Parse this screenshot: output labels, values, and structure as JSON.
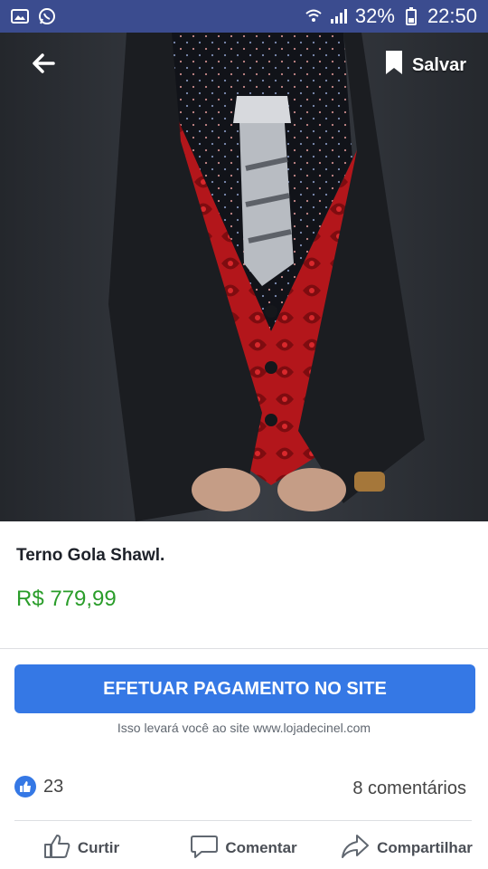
{
  "status_bar": {
    "battery": "32%",
    "time": "22:50",
    "icons": [
      "image-icon",
      "whatsapp-icon",
      "wifi-icon",
      "signal-icon",
      "battery-icon"
    ]
  },
  "header": {
    "back_icon": "arrow-left-icon",
    "save_label": "Salvar",
    "save_icon": "bookmark-icon"
  },
  "product": {
    "title": "Terno Gola Shawl.",
    "price": "R$ 779,99"
  },
  "cta": {
    "label": "EFETUAR PAGAMENTO NO SITE",
    "note": "Isso levará você ao site www.lojadecinel.com"
  },
  "engagement": {
    "likes": "23",
    "comments": "8 comentários"
  },
  "actions": {
    "like": "Curtir",
    "comment": "Comentar",
    "share": "Compartilhar"
  },
  "colors": {
    "status_bar": "#3b4c8f",
    "price": "#2a9d2a",
    "cta": "#3578e5"
  }
}
